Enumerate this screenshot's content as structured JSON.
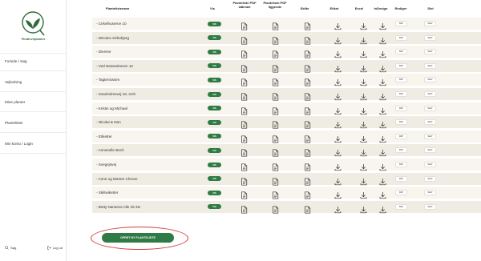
{
  "sidebar": {
    "logo_text": "Findleveplanter",
    "items": [
      "Forside / Søg",
      "Vejledning",
      "Mine planter",
      "Plantelister",
      "Min konto / Login"
    ],
    "search_label": "Søg",
    "logout_label": "Log ud"
  },
  "table": {
    "headers": {
      "name": "Plantelistenavn",
      "vis": "Vis",
      "pdf_stående": "Planteliste PDF stående",
      "pdf_liggende": "Planteliste PDF liggende",
      "skilte": "Skilte",
      "etiket": "Etiket",
      "excel": "Excel",
      "indesign": "InDesign",
      "rediger": "Rediger",
      "slet": "Slet"
    },
    "vis_label": "VIS",
    "edit_label": "RET",
    "delete_label": "SLET",
    "rows": [
      "- Cirkelhuserne 10",
      "- Wicotec Kirkebjerg",
      "- Diverse",
      "- Ved Nesseskoven 12",
      "- Tagterrassen",
      "- Svanholmsvej 18, st.th",
      "- Kristin og Michael",
      "- Nicolai & Nan",
      "- Etiketter",
      "- Annesofie Bech",
      "- Svegsjövej",
      "- Anne og Morten Chrone",
      "- Skiltwiketter",
      "- Betty Nansens Alle 25 3tv"
    ]
  },
  "create_button": "OPRET NY PLANTELISTE",
  "colors": {
    "accent": "#2f7a45",
    "highlight": "#d63a3a"
  }
}
